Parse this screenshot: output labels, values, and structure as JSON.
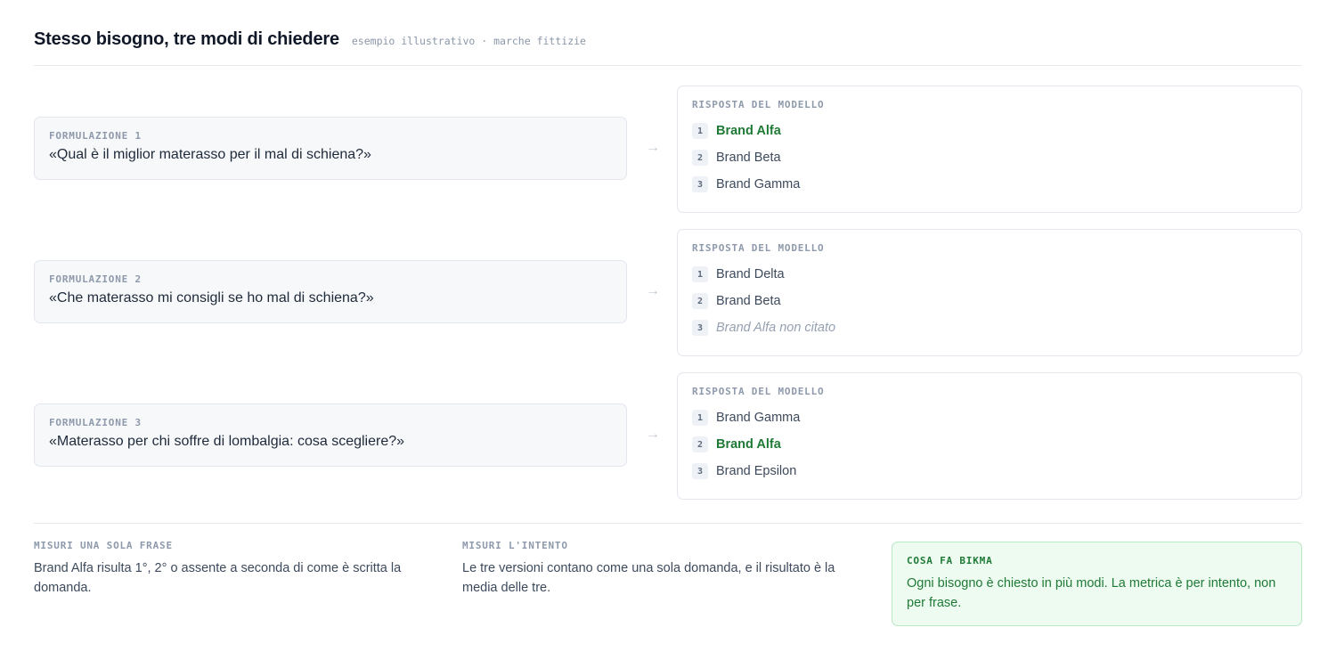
{
  "header": {
    "title": "Stesso bisogno, tre modi di chiedere",
    "subtitle": "esempio illustrativo · marche fittizie"
  },
  "arrow_glyph": "→",
  "answer_label": "RISPOSTA DEL MODELLO",
  "rows": [
    {
      "label": "FORMULAZIONE 1",
      "question": "«Qual è il miglior materasso per il mal di schiena?»",
      "answers": [
        {
          "rank": "1",
          "text": "Brand Alfa",
          "style": "highlight"
        },
        {
          "rank": "2",
          "text": "Brand Beta",
          "style": "normal"
        },
        {
          "rank": "3",
          "text": "Brand Gamma",
          "style": "normal"
        }
      ]
    },
    {
      "label": "FORMULAZIONE 2",
      "question": "«Che materasso mi consigli se ho mal di schiena?»",
      "answers": [
        {
          "rank": "1",
          "text": "Brand Delta",
          "style": "normal"
        },
        {
          "rank": "2",
          "text": "Brand Beta",
          "style": "normal"
        },
        {
          "rank": "3",
          "text": "Brand Alfa non citato",
          "style": "absent"
        }
      ]
    },
    {
      "label": "FORMULAZIONE 3",
      "question": "«Materasso per chi soffre di lombalgia: cosa scegliere?»",
      "answers": [
        {
          "rank": "1",
          "text": "Brand Gamma",
          "style": "normal"
        },
        {
          "rank": "2",
          "text": "Brand Alfa",
          "style": "highlight"
        },
        {
          "rank": "3",
          "text": "Brand Epsilon",
          "style": "normal"
        }
      ]
    }
  ],
  "footer": {
    "single": {
      "label": "MISURI UNA SOLA FRASE",
      "text": "Brand Alfa risulta 1°, 2° o assente a seconda di come è scritta la domanda."
    },
    "intent": {
      "label": "MISURI L'INTENTO",
      "text": "Le tre versioni contano come una sola domanda, e il risultato è la media delle tre."
    },
    "bikma": {
      "label": "COSA FA BIKMA",
      "text": "Ogni bisogno è chiesto in più modi. La metrica è per intento, non per frase."
    }
  },
  "colors": {
    "highlight": "#1f7a36",
    "absent": "#94a0b0",
    "green_bg": "#eefbf1",
    "green_border": "#b9e8c5"
  }
}
